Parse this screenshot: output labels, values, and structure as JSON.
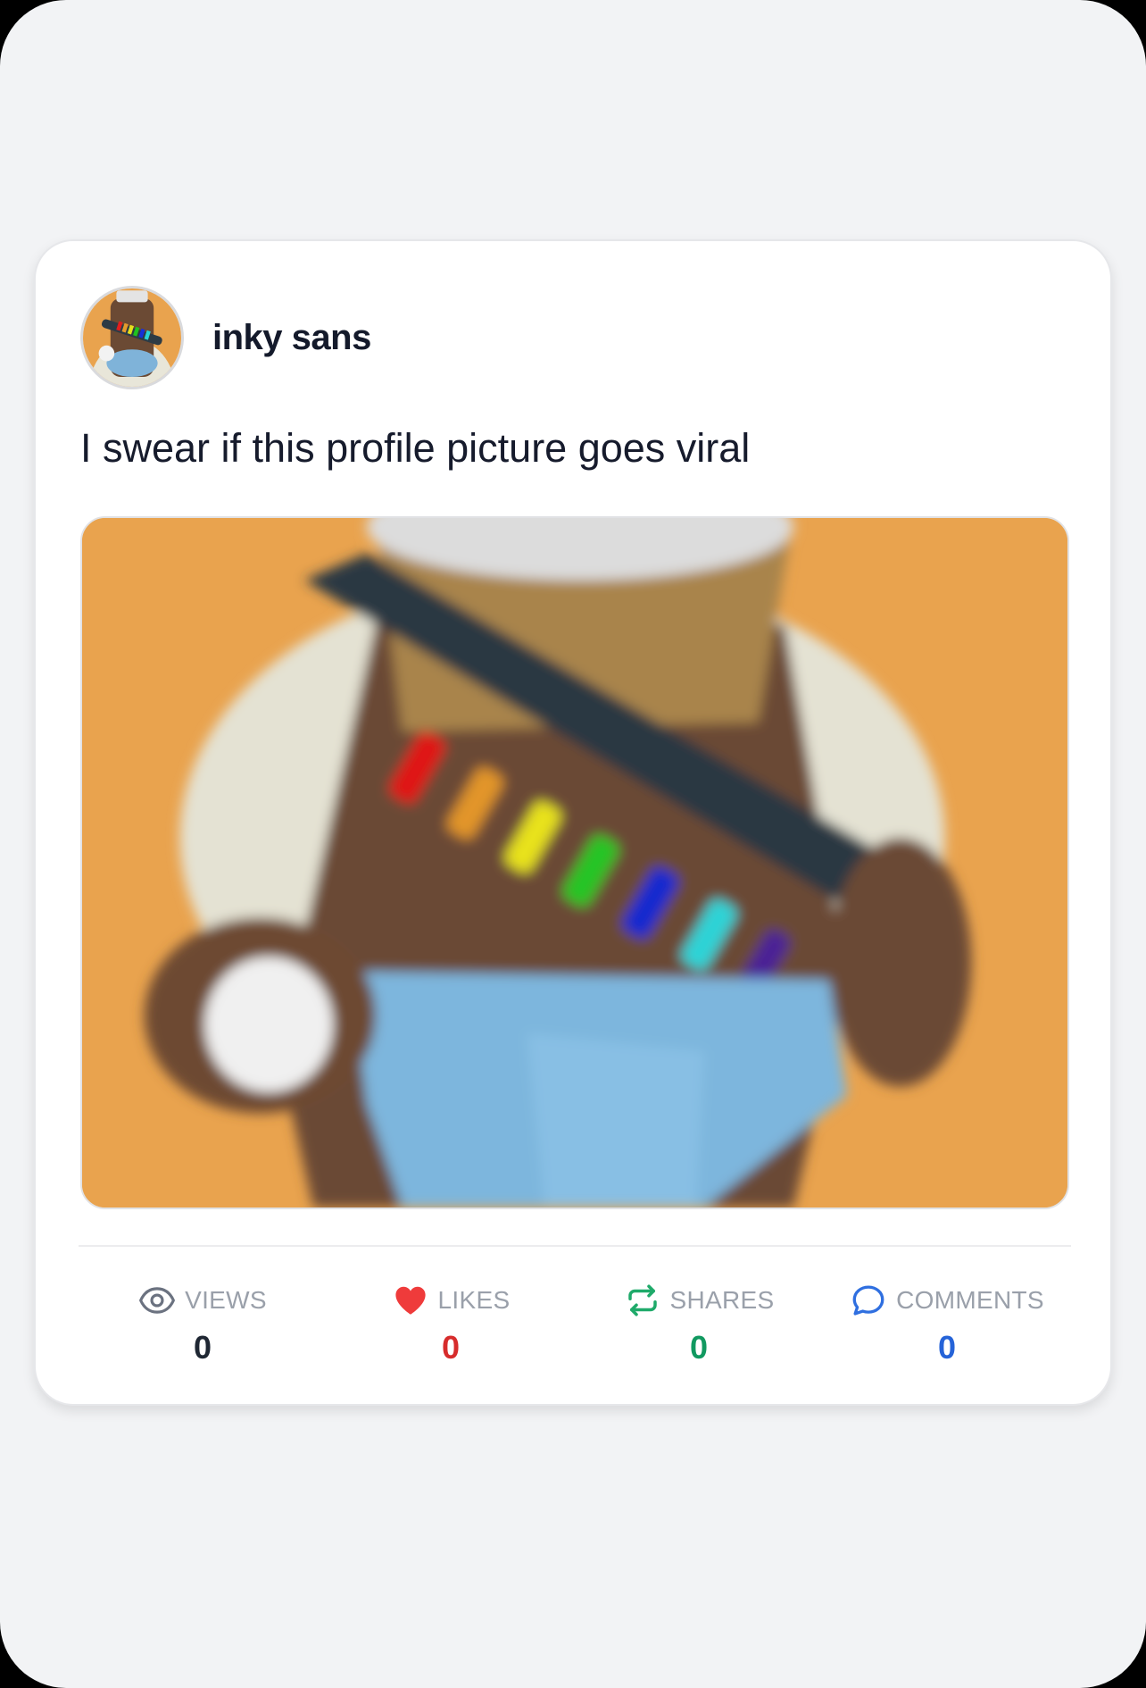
{
  "post": {
    "author": "inky sans",
    "text": "I swear if this profile picture goes viral",
    "avatar_icon": "roblox-character-avatar",
    "image_description_icon": "roblox-character-image"
  },
  "stats": {
    "views": {
      "label": "VIEWS",
      "value": "0",
      "icon": "eye-icon",
      "color": "#1f2733"
    },
    "likes": {
      "label": "LIKES",
      "value": "0",
      "icon": "heart-icon",
      "color": "#d72c2c"
    },
    "shares": {
      "label": "SHARES",
      "value": "0",
      "icon": "repost-icon",
      "color": "#119960"
    },
    "comments": {
      "label": "COMMENTS",
      "value": "0",
      "icon": "comment-icon",
      "color": "#2563d8"
    }
  },
  "colors": {
    "background": "#f2f3f5",
    "card": "#ffffff",
    "image_bg": "#e9a34e"
  }
}
